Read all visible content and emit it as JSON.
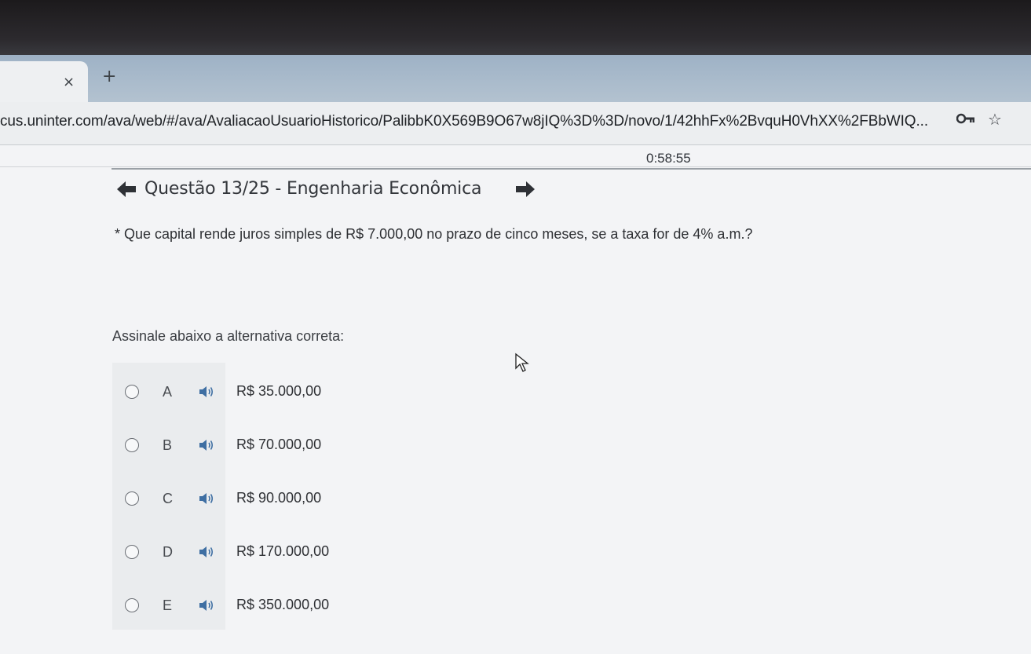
{
  "browser": {
    "tab_close": "×",
    "new_tab": "+",
    "url": "cus.uninter.com/ava/web/#/ava/AvaliacaoUsuarioHistorico/PalibbK0X569B9O67w8jIQ%3D%3D/novo/1/42hhFx%2BvquH0VhXX%2FBbWIQ...",
    "star": "☆"
  },
  "exam": {
    "timer": "0:58:55",
    "question_title": "Questão 13/25 - Engenharia Econômica",
    "question_text": "* Que capital rende juros simples de R$ 7.000,00 no prazo de cinco meses, se a taxa for de 4% a.m.?",
    "instruction": "Assinale abaixo a alternativa correta:",
    "options": [
      {
        "letter": "A",
        "text": "R$ 35.000,00"
      },
      {
        "letter": "B",
        "text": "R$ 70.000,00"
      },
      {
        "letter": "C",
        "text": "R$ 90.000,00"
      },
      {
        "letter": "D",
        "text": "R$ 170.000,00"
      },
      {
        "letter": "E",
        "text": "R$ 350.000,00"
      }
    ]
  },
  "icons": {
    "prev": "arrow-left-icon",
    "next": "arrow-right-icon",
    "speaker": "speaker-icon",
    "key": "key-icon",
    "cursor": "mouse-pointer-icon"
  },
  "colors": {
    "speaker": "#3f6fa3",
    "arrow": "#2e3136",
    "tabbar": "#a9bccd"
  }
}
